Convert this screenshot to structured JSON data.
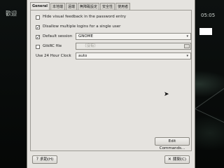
{
  "background": {
    "title": "歡迎",
    "clock": "05:05"
  },
  "tabs": [
    "General",
    "本地端",
    "遠端",
    "無障礙設定",
    "安全性",
    "使用者"
  ],
  "general": {
    "hide_feedback": {
      "label": "Hide visual feedback in the password entry",
      "checked": false
    },
    "disallow_multiple": {
      "label": "Disallow multiple logins for a single user",
      "checked": true
    },
    "default_session": {
      "label": "Default session",
      "checked": true,
      "value": "GNOME"
    },
    "gtkrc": {
      "label": "GtkRC file",
      "checked": false,
      "placeholder": "（沒有）"
    },
    "clock_24": {
      "label": "Use 24 Hour Clock",
      "value": "auto"
    }
  },
  "buttons": {
    "edit_commands": "Edit Commands...",
    "help": "求助(H)",
    "close": "關閉(C)"
  },
  "icons": {
    "combo_arrow": "▾",
    "help": "?",
    "close": "✕",
    "cursor": "pointer-arrow"
  }
}
